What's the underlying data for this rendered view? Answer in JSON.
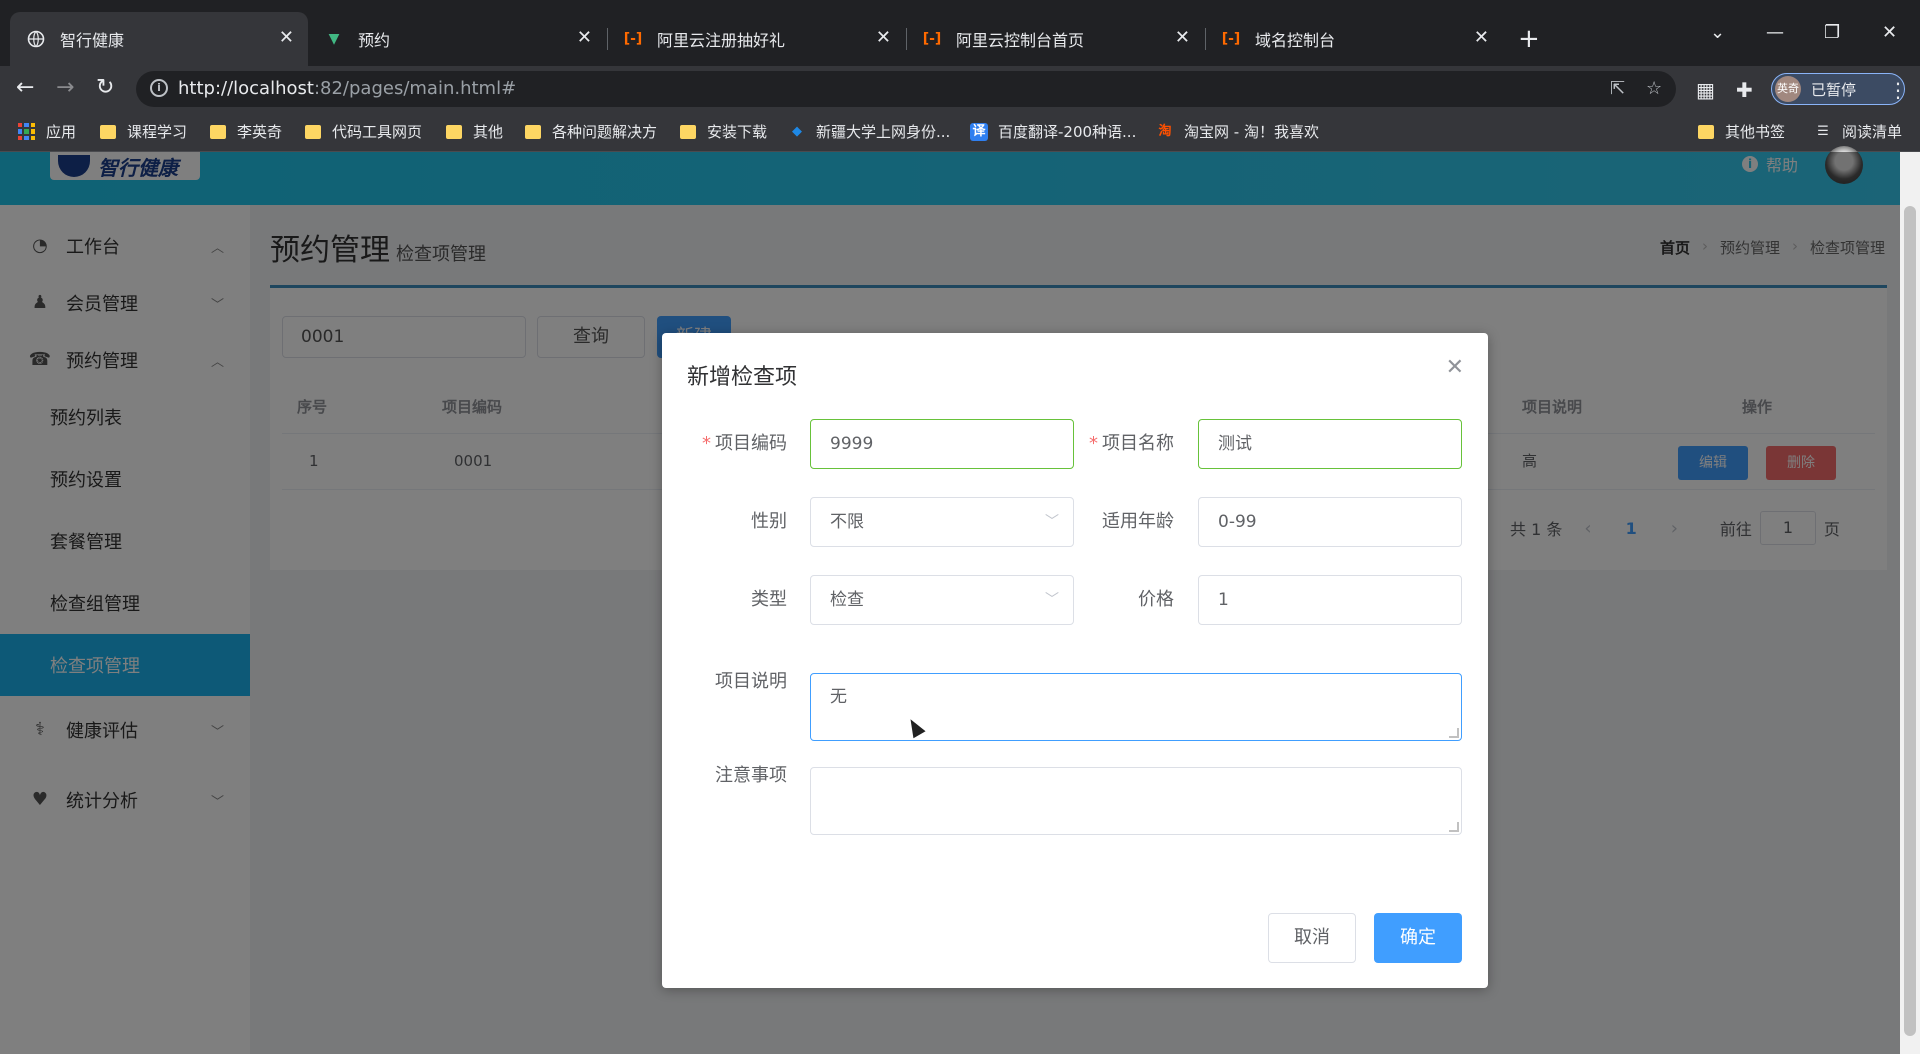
{
  "browser": {
    "tabs": [
      {
        "title": "智行健康",
        "icon": "globe-icon"
      },
      {
        "title": "预约",
        "icon": "vue-icon"
      },
      {
        "title": "阿里云注册抽好礼",
        "icon": "aliyun-icon"
      },
      {
        "title": "阿里云控制台首页",
        "icon": "aliyun-icon"
      },
      {
        "title": "域名控制台",
        "icon": "aliyun-icon"
      }
    ],
    "url_host": "http://localhost",
    "url_rest": ":82/pages/main.html#",
    "profile_avatar": "英奇",
    "profile_label": "已暂停",
    "bookmarks": [
      {
        "label": "应用"
      },
      {
        "label": "课程学习"
      },
      {
        "label": "李英奇"
      },
      {
        "label": "代码工具网页"
      },
      {
        "label": "其他"
      },
      {
        "label": "各种问题解决方"
      },
      {
        "label": "安装下载"
      },
      {
        "label": "新疆大学上网身份..."
      },
      {
        "label": "百度翻译-200种语..."
      },
      {
        "label": "淘宝网 - 淘！我喜欢"
      },
      {
        "label": "其他书签"
      },
      {
        "label": "阅读清单"
      }
    ]
  },
  "header": {
    "logo_text": "智行健康",
    "help_label": "帮助"
  },
  "sidebar": {
    "items": [
      {
        "label": "工作台",
        "icon": "dashboard-icon"
      },
      {
        "label": "会员管理",
        "icon": "user-icon"
      },
      {
        "label": "预约管理",
        "icon": "phone-icon"
      },
      {
        "label": "健康评估",
        "icon": "stethoscope-icon"
      },
      {
        "label": "统计分析",
        "icon": "heartbeat-icon"
      }
    ],
    "sub_items": [
      {
        "label": "预约列表"
      },
      {
        "label": "预约设置"
      },
      {
        "label": "套餐管理"
      },
      {
        "label": "检查组管理"
      },
      {
        "label": "检查项管理",
        "active": true
      }
    ]
  },
  "page": {
    "title": "预约管理",
    "subtitle": "检查项管理",
    "breadcrumb": [
      "首页",
      "预约管理",
      "检查项管理"
    ],
    "filter_value": "0001",
    "query_label": "查询",
    "new_label": "新建",
    "table": {
      "headers": [
        "序号",
        "项目编码",
        "项目说明",
        "操作"
      ],
      "rows": [
        {
          "index": "1",
          "code": "0001",
          "desc_partial": "高"
        }
      ],
      "edit_label": "编辑",
      "delete_label": "删除"
    },
    "pagination": {
      "total": "共 1 条",
      "current": "1",
      "goto_label": "前往",
      "goto_value": "1",
      "page_suffix": "页"
    }
  },
  "dialog": {
    "title": "新增检查项",
    "fields": {
      "code_label": "项目编码",
      "code_value": "9999",
      "name_label": "项目名称",
      "name_value": "测试",
      "sex_label": "性别",
      "sex_value": "不限",
      "age_label": "适用年龄",
      "age_value": "0-99",
      "type_label": "类型",
      "type_value": "检查",
      "price_label": "价格",
      "price_value": "1",
      "remark_label": "项目说明",
      "remark_value": "无",
      "attention_label": "注意事项",
      "attention_value": ""
    },
    "cancel_label": "取消",
    "confirm_label": "确定"
  },
  "colors": {
    "primary": "#409eff",
    "danger": "#f56c6c",
    "success_border": "#67c23a",
    "sidebar_active": "#1ab3ef",
    "header": "#30c7ed"
  }
}
